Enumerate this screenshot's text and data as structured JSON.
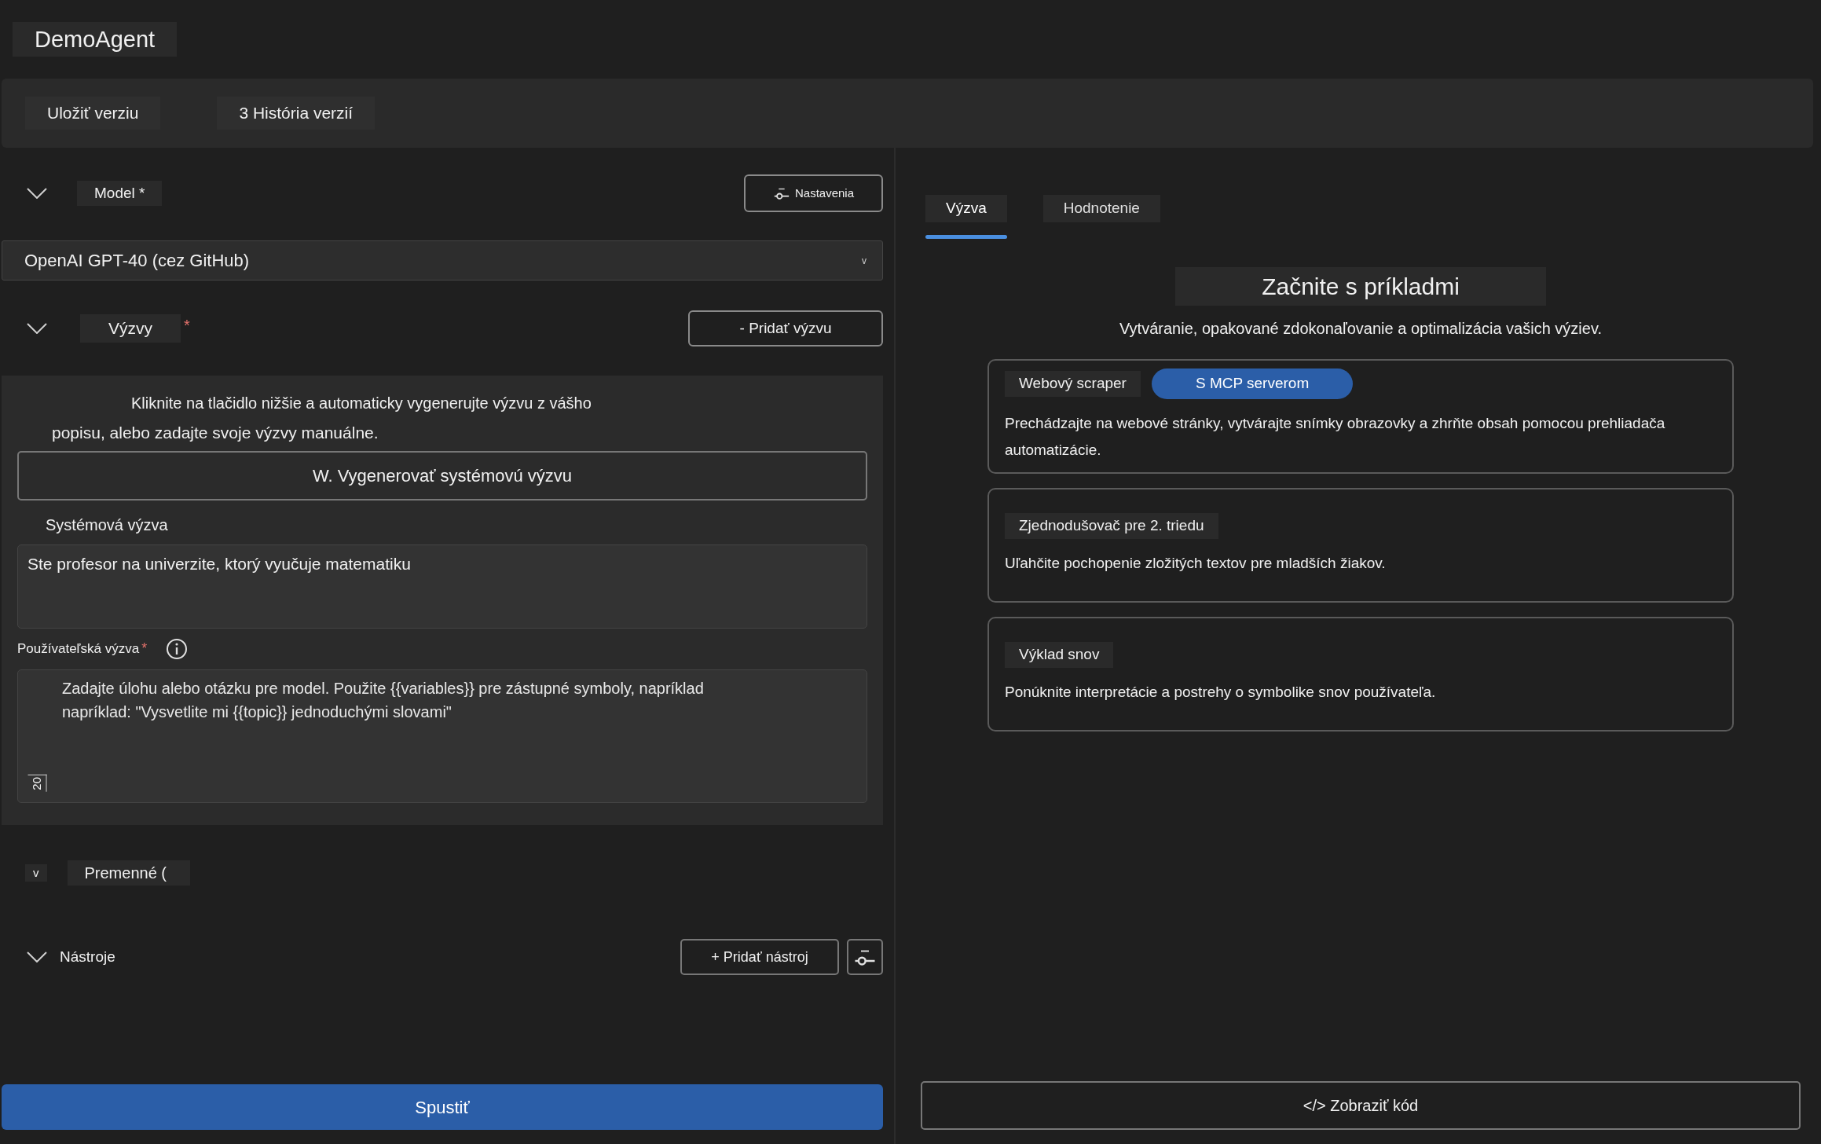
{
  "title": "DemoAgent",
  "toolbar": [
    {
      "label": "Uložiť verziu"
    },
    {
      "label": "3 História verzií"
    }
  ],
  "model": {
    "label": "Model *",
    "settings_button": "Nastavenia",
    "value": "OpenAI GPT-40 (cez GitHub)",
    "caret": "v"
  },
  "prompts": {
    "label": "Výzvy",
    "required_mark": "*",
    "add_button": "- Pridať výzvu",
    "hint_lines": [
      "Kliknite na tlačidlo nižšie a automaticky vygenerujte výzvu z vášho",
      "popisu, alebo zadajte svoje výzvy manuálne."
    ],
    "generate_button": "W. Vygenerovať systémovú výzvu",
    "system_label": "Systémová výzva",
    "system_value": "Ste profesor na univerzite, ktorý vyučuje matematiku",
    "user_label": "Používateľská výzva",
    "user_required_mark": "*",
    "user_placeholder": "Zadajte úlohu alebo otázku pre model. Použite {{variables}} pre zástupné symboly, napríklad\nnapríklad: \"Vysvetlite mi {{topic}} jednoduchými slovami\"",
    "counter": "20"
  },
  "variables": {
    "toggle": "v",
    "label": "Premenné ("
  },
  "tools": {
    "label": "Nástroje",
    "add_button": "+ Pridať nástroj"
  },
  "run_button": "Spustiť",
  "tabs": [
    {
      "label": "Výzva",
      "selected": true
    },
    {
      "label": "Hodnotenie",
      "selected": false
    }
  ],
  "examples": {
    "heading": "Začnite s príkladmi",
    "subtitle": "Vytváranie, opakované zdokonaľovanie a optimalizácia vašich výziev.",
    "cards": [
      {
        "title": "Webový scraper",
        "badge": "S MCP serverom",
        "description": "Prechádzajte na webové stránky, vytvárajte snímky obrazovky a zhrňte obsah pomocou prehliadača automatizácie."
      },
      {
        "title": "Zjednodušovač pre 2. triedu",
        "description": "Uľahčite pochopenie zložitých textov pre mladších žiakov."
      },
      {
        "title": "Výklad snov",
        "description": "Ponúknite interpretácie a postrehy o symbolike snov používateľa."
      }
    ]
  },
  "view_code_button": "</> Zobraziť kód"
}
